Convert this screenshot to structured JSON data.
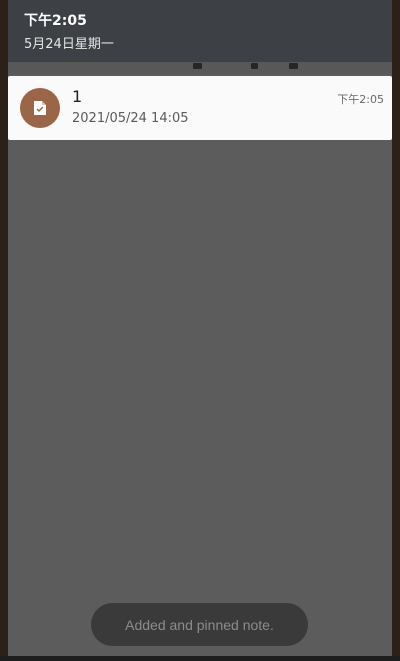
{
  "status_shade": {
    "time": "下午2:05",
    "date": "5月24日星期一"
  },
  "notification": {
    "icon": "note-icon",
    "title": "1",
    "text": "2021/05/24 14:05",
    "time": "下午2:05"
  },
  "toast": {
    "message": "Added and pinned note."
  },
  "colors": {
    "shade_header": "#3d4146",
    "dim_overlay": "#5c5c5c",
    "app_icon_bg": "#9b6548",
    "card_bg": "#fafafa",
    "toast_bg": "#3a3a3a"
  }
}
